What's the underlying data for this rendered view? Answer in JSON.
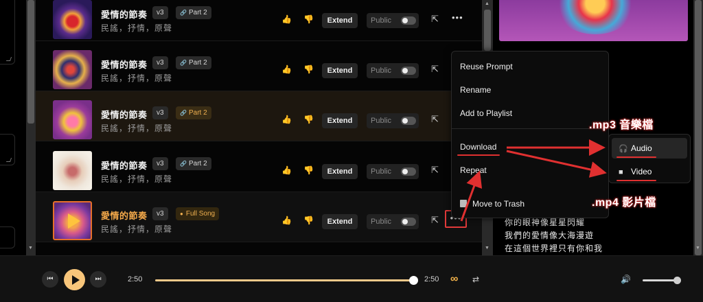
{
  "songs": [
    {
      "title": "愛情的節奏",
      "version": "v3",
      "tag": "Part 2",
      "genre": "民謠，抒情，原聲",
      "liked": false
    },
    {
      "title": "愛情的節奏",
      "version": "v3",
      "tag": "Part 2",
      "genre": "民謠，抒情，原聲",
      "liked": false
    },
    {
      "title": "愛情的節奏",
      "version": "v3",
      "tag": "Part 2",
      "genre": "民謠，抒情，原聲",
      "liked": true
    },
    {
      "title": "愛情的節奏",
      "version": "v3",
      "tag": "Part 2",
      "genre": "民謠，抒情，原聲",
      "liked": false
    },
    {
      "title": "愛情的節奏",
      "version": "v3",
      "tag": "Full Song",
      "genre": "民謠，抒情，原聲",
      "liked": false
    }
  ],
  "row_actions": {
    "extend": "Extend",
    "public": "Public",
    "more": "•••"
  },
  "menu": {
    "reuse_prompt": "Reuse Prompt",
    "rename": "Rename",
    "add_to_playlist": "Add to Playlist",
    "download": "Download",
    "repeat": "Repeat",
    "move_to_trash": "Move to Trash"
  },
  "download_submenu": {
    "audio": "Audio",
    "video": "Video"
  },
  "annotations": {
    "mp3": ".mp3 音樂檔",
    "mp4": ".mp4 影片檔"
  },
  "lyrics": [
    "你的眼神像星星閃耀",
    "我們的愛情像大海漫遊",
    "在這個世界裡只有你和我"
  ],
  "player": {
    "current_time": "2:50",
    "total_time": "2:50",
    "progress": 1.0,
    "volume": 1.0
  },
  "colors": {
    "accent": "#f2b24a",
    "annotation_red": "#e03030"
  }
}
